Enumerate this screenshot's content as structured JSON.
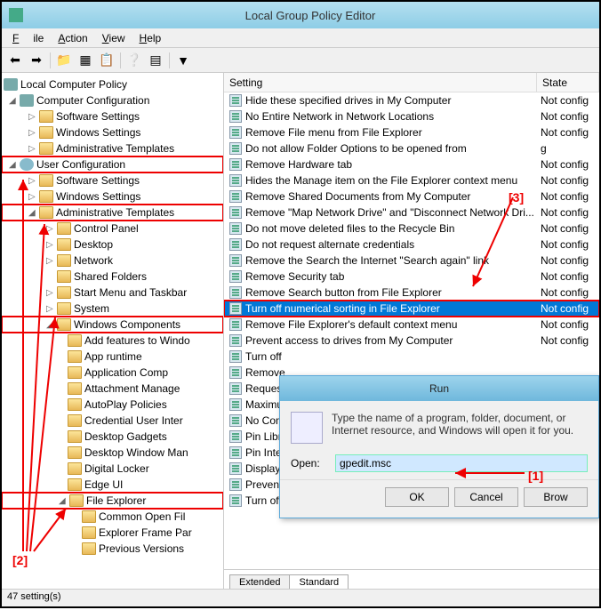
{
  "window": {
    "title": "Local Group Policy Editor"
  },
  "menu": {
    "file": "File",
    "action": "Action",
    "view": "View",
    "help": "Help"
  },
  "tree": {
    "root": "Local Computer Policy",
    "computer_config": "Computer Configuration",
    "cc_software": "Software Settings",
    "cc_windows": "Windows Settings",
    "cc_admin": "Administrative Templates",
    "user_config": "User Configuration",
    "uc_software": "Software Settings",
    "uc_windows": "Windows Settings",
    "uc_admin": "Administrative Templates",
    "cp": "Control Panel",
    "desktop": "Desktop",
    "network": "Network",
    "shared": "Shared Folders",
    "startmenu": "Start Menu and Taskbar",
    "system": "System",
    "wincomp": "Windows Components",
    "wc_add": "Add features to Windo",
    "wc_apprun": "App runtime",
    "wc_appcomp": "Application Comp",
    "wc_attach": "Attachment Manage",
    "wc_autoplay": "AutoPlay Policies",
    "wc_cred": "Credential User Inter",
    "wc_gadgets": "Desktop Gadgets",
    "wc_deskwin": "Desktop Window Man",
    "wc_digital": "Digital Locker",
    "wc_edge": "Edge UI",
    "wc_fileexp": "File Explorer",
    "wc_common": "Common Open Fil",
    "wc_expframe": "Explorer Frame Par",
    "wc_prev": "Previous Versions"
  },
  "list": {
    "header_setting": "Setting",
    "header_state": "State",
    "rows": [
      {
        "s": "Hide these specified drives in My Computer",
        "st": "Not config"
      },
      {
        "s": "No Entire Network in Network Locations",
        "st": "Not config"
      },
      {
        "s": "Remove File menu from File Explorer",
        "st": "Not config"
      },
      {
        "s": "Do not allow Folder Options to be opened from",
        "st": "g"
      },
      {
        "s": "Remove Hardware tab",
        "st": "Not config"
      },
      {
        "s": "Hides the Manage item on the File Explorer context menu",
        "st": "Not config"
      },
      {
        "s": "Remove Shared Documents from My Computer",
        "st": "Not config"
      },
      {
        "s": "Remove \"Map Network Drive\" and \"Disconnect Network Dri...",
        "st": "Not config"
      },
      {
        "s": "Do not move deleted files to the Recycle Bin",
        "st": "Not config"
      },
      {
        "s": "Do not request alternate credentials",
        "st": "Not config"
      },
      {
        "s": "Remove the Search the Internet \"Search again\" link",
        "st": "Not config"
      },
      {
        "s": "Remove Security tab",
        "st": "Not config"
      },
      {
        "s": "Remove Search button from File Explorer",
        "st": "Not config"
      },
      {
        "s": "Turn off numerical sorting in File Explorer",
        "st": "Not config",
        "sel": true
      },
      {
        "s": "Remove File Explorer's default context menu",
        "st": "Not config"
      },
      {
        "s": "Prevent access to drives from My Computer",
        "st": "Not config"
      },
      {
        "s": "Turn off",
        "st": ""
      },
      {
        "s": "Remove",
        "st": ""
      },
      {
        "s": "Request t",
        "st": ""
      },
      {
        "s": "Maximum",
        "st": ""
      },
      {
        "s": "No Comp",
        "st": ""
      },
      {
        "s": "Pin Libra",
        "st": ""
      },
      {
        "s": "Pin Intern",
        "st": ""
      },
      {
        "s": "Display t",
        "st": ""
      },
      {
        "s": "Prevent c",
        "st": ""
      },
      {
        "s": "Turn off",
        "st": ""
      }
    ],
    "tabs": {
      "extended": "Extended",
      "standard": "Standard"
    }
  },
  "statusbar": {
    "text": "47 setting(s)"
  },
  "run": {
    "title": "Run",
    "desc": "Type the name of a program, folder, document, or Internet resource, and Windows will open it for you.",
    "open_label": "Open:",
    "value": "gpedit.msc",
    "ok": "OK",
    "cancel": "Cancel",
    "browse": "Brow"
  },
  "annotations": {
    "a1": "[1]",
    "a2": "[2]",
    "a3": "[3]"
  }
}
